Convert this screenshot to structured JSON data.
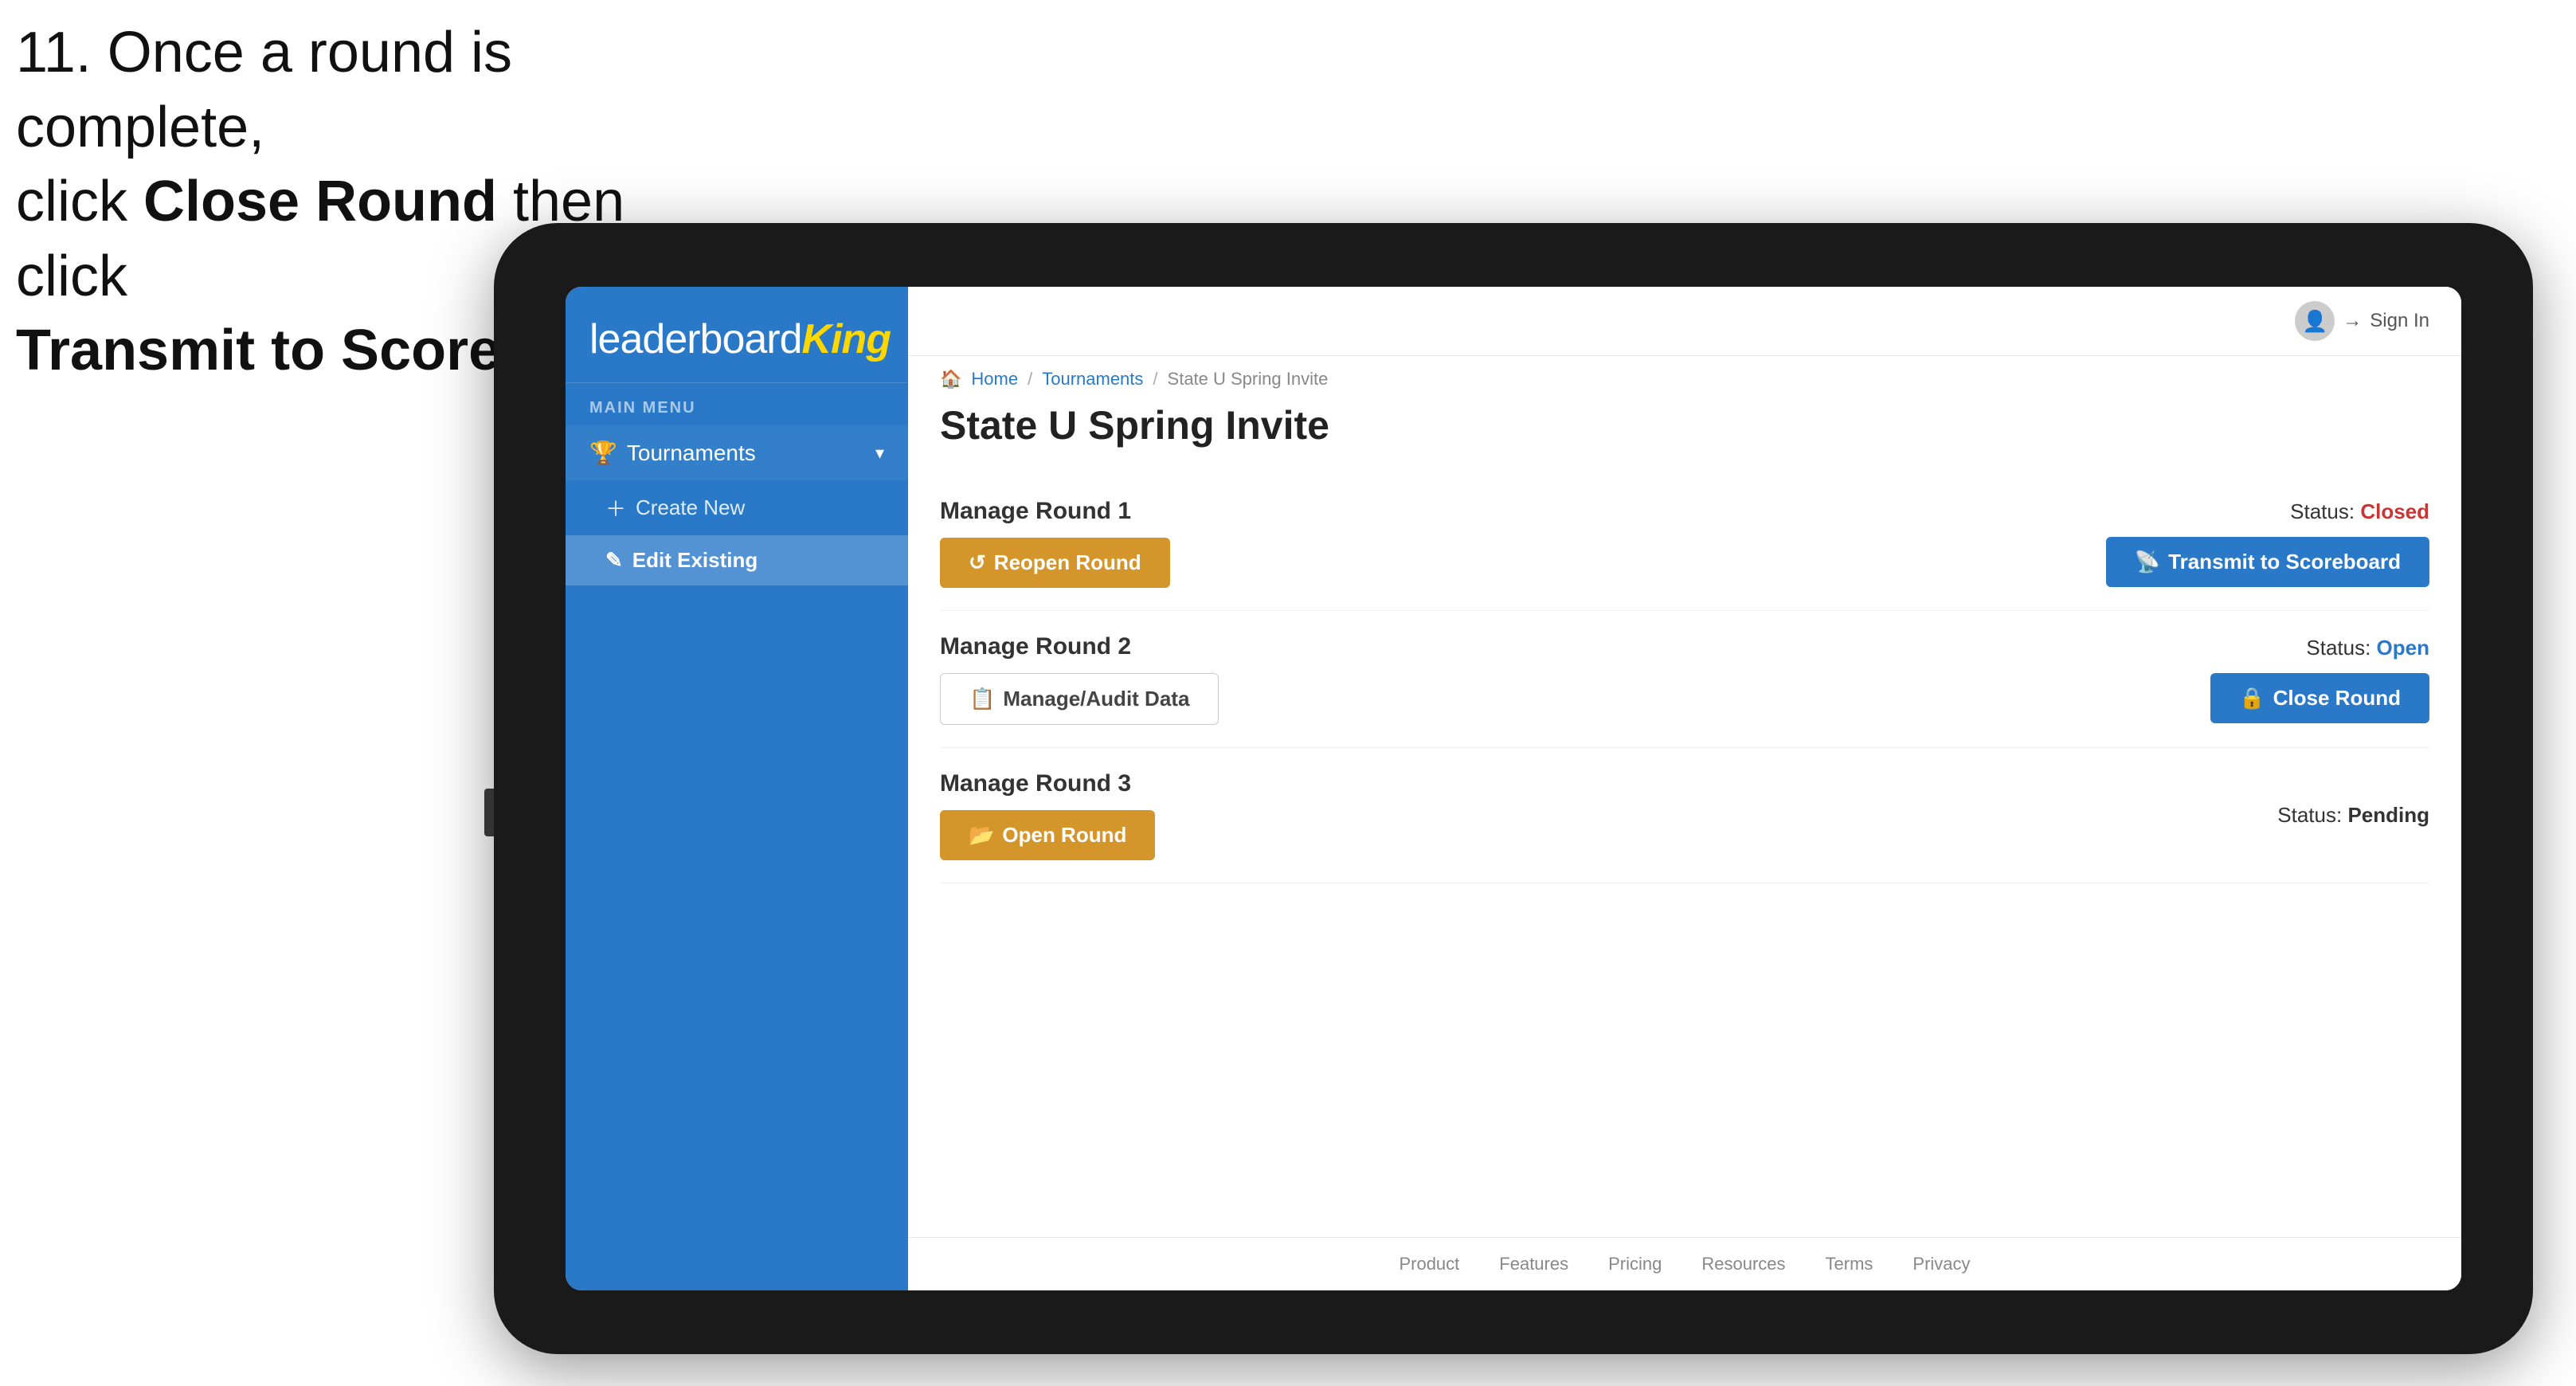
{
  "instruction": {
    "line1": "11. Once a round is complete,",
    "line2": "click ",
    "bold1": "Close Round",
    "line3": " then click",
    "bold2": "Transmit to Scoreboard."
  },
  "logo": {
    "text_regular": "leaderboard",
    "text_bold": "King"
  },
  "sidebar": {
    "menu_label": "MAIN MENU",
    "items": [
      {
        "label": "Tournaments",
        "icon": "trophy",
        "expanded": true,
        "sub_items": [
          {
            "label": "Create New",
            "icon": "plus",
            "active": false
          },
          {
            "label": "Edit Existing",
            "icon": "edit",
            "active": true
          }
        ]
      }
    ]
  },
  "topbar": {
    "sign_in_label": "Sign In"
  },
  "breadcrumb": {
    "home": "Home",
    "tournaments": "Tournaments",
    "current": "State U Spring Invite"
  },
  "page": {
    "title": "State U Spring Invite"
  },
  "rounds": [
    {
      "title": "Manage Round 1",
      "status_label": "Status:",
      "status_value": "Closed",
      "status_type": "closed",
      "buttons": [
        {
          "label": "Reopen Round",
          "type": "gold",
          "icon": "reopen"
        }
      ],
      "right_buttons": [
        {
          "label": "Transmit to Scoreboard",
          "type": "blue",
          "icon": "transmit"
        }
      ]
    },
    {
      "title": "Manage Round 2",
      "status_label": "Status:",
      "status_value": "Open",
      "status_type": "open",
      "buttons": [
        {
          "label": "Manage/Audit Data",
          "type": "outline",
          "icon": "data"
        }
      ],
      "right_buttons": [
        {
          "label": "Close Round",
          "type": "blue",
          "icon": "lock"
        }
      ]
    },
    {
      "title": "Manage Round 3",
      "status_label": "Status:",
      "status_value": "Pending",
      "status_type": "pending",
      "buttons": [
        {
          "label": "Open Round",
          "type": "gold",
          "icon": "open"
        }
      ],
      "right_buttons": []
    }
  ],
  "footer": {
    "links": [
      "Product",
      "Features",
      "Pricing",
      "Resources",
      "Terms",
      "Privacy"
    ]
  }
}
